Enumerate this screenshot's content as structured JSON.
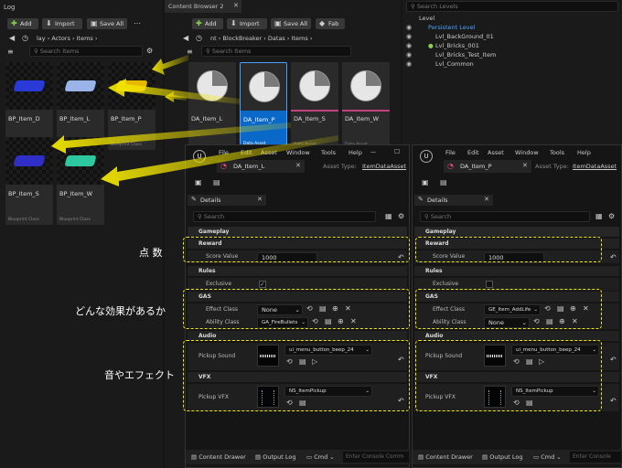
{
  "log_panel": {
    "title": "Log",
    "add": "Add",
    "import": "Import",
    "save_all": "Save All",
    "path": [
      "lay",
      "Actors",
      "Items"
    ],
    "search": "Search Items",
    "items": [
      {
        "name": "BP_Item_D",
        "kind": "Blueprint Class",
        "color": "#2a3ad8"
      },
      {
        "name": "BP_Item_L",
        "kind": "Blueprint Class",
        "color": "#9ab4ea"
      },
      {
        "name": "BP_Item_P",
        "kind": "Blueprint Class",
        "color": "#e6b800"
      },
      {
        "name": "BP_Item_S",
        "kind": "Blueprint Class",
        "color": "#2f2fc8"
      },
      {
        "name": "BP_Item_W",
        "kind": "Blueprint Class",
        "color": "#2ec8a0"
      }
    ]
  },
  "cb2": {
    "title": "Content Browser 2",
    "add": "Add",
    "import": "Import",
    "save_all": "Save All",
    "fab": "Fab",
    "path": [
      "nt",
      "BlockBreaker",
      "Datas",
      "Items"
    ],
    "search": "Search Items",
    "items": [
      {
        "name": "DA_Item_L",
        "kind": ""
      },
      {
        "name": "DA_Item_P",
        "kind": "Data Asset"
      },
      {
        "name": "DA_Item_S",
        "kind": "Data Asset"
      },
      {
        "name": "DA_Item_W",
        "kind": "Data Asset"
      }
    ]
  },
  "outliner": {
    "search": "Search Levels",
    "header": "Level",
    "items": [
      "Persistent Level",
      "Lvl_BackGround_01",
      "Lvl_Bricks_001",
      "Lvl_Bricks_Test_Item",
      "Lvl_Common"
    ]
  },
  "editors": [
    {
      "menu": [
        "File",
        "Edit",
        "Asset",
        "Window",
        "Tools",
        "Help"
      ],
      "tab": "DA_Item_L",
      "asset_type_label": "Asset Type:",
      "asset_type": "ItemDataAsset",
      "details": "Details",
      "search": "Search",
      "gameplay": "Gameplay",
      "reward": "Reward",
      "score_label": "Score Value",
      "score": "1000",
      "rules": "Rules",
      "exclusive": "Exclusive",
      "gas": "GAS",
      "effect_label": "Effect Class",
      "effect": "None",
      "ability_label": "Ability Class",
      "ability": "GA_FireBullets",
      "audio": "Audio",
      "sound_label": "Pickup Sound",
      "sound": "ui_menu_button_beep_24",
      "vfx": "VFX",
      "vfx_label": "Pickup VFX",
      "vfx_value": "NS_ItemPickup",
      "content_drawer": "Content Drawer",
      "output_log": "Output Log",
      "cmd": "Cmd",
      "console": "Enter Console Comm"
    },
    {
      "menu": [
        "File",
        "Edit",
        "Asset",
        "Window",
        "Tools",
        "Help"
      ],
      "tab": "DA_Item_P",
      "asset_type_label": "Asset Type:",
      "asset_type": "ItemDataAsset",
      "details": "Details",
      "search": "Search",
      "gameplay": "Gameplay",
      "reward": "Reward",
      "score_label": "Score Value",
      "score": "1000",
      "rules": "Rules",
      "exclusive": "Exclusive",
      "gas": "GAS",
      "effect_label": "Effect Class",
      "effect": "GE_Item_AddLife",
      "ability_label": "Ability Class",
      "ability": "None",
      "audio": "Audio",
      "sound_label": "Pickup Sound",
      "sound": "ui_menu_button_beep_24",
      "vfx": "VFX",
      "vfx_label": "Pickup VFX",
      "vfx_value": "NS_ItemPickup",
      "content_drawer": "Content Drawer",
      "output_log": "Output Log",
      "cmd": "Cmd",
      "console": "Enter Console Comm"
    }
  ],
  "annotations": {
    "reward": "点 数",
    "gas": "どんな効果があるか",
    "audio": "音やエフェクト"
  },
  "colors": {
    "highlight": "#f3e600",
    "selected": "#0a68c8",
    "accent": "#8ad24a"
  }
}
